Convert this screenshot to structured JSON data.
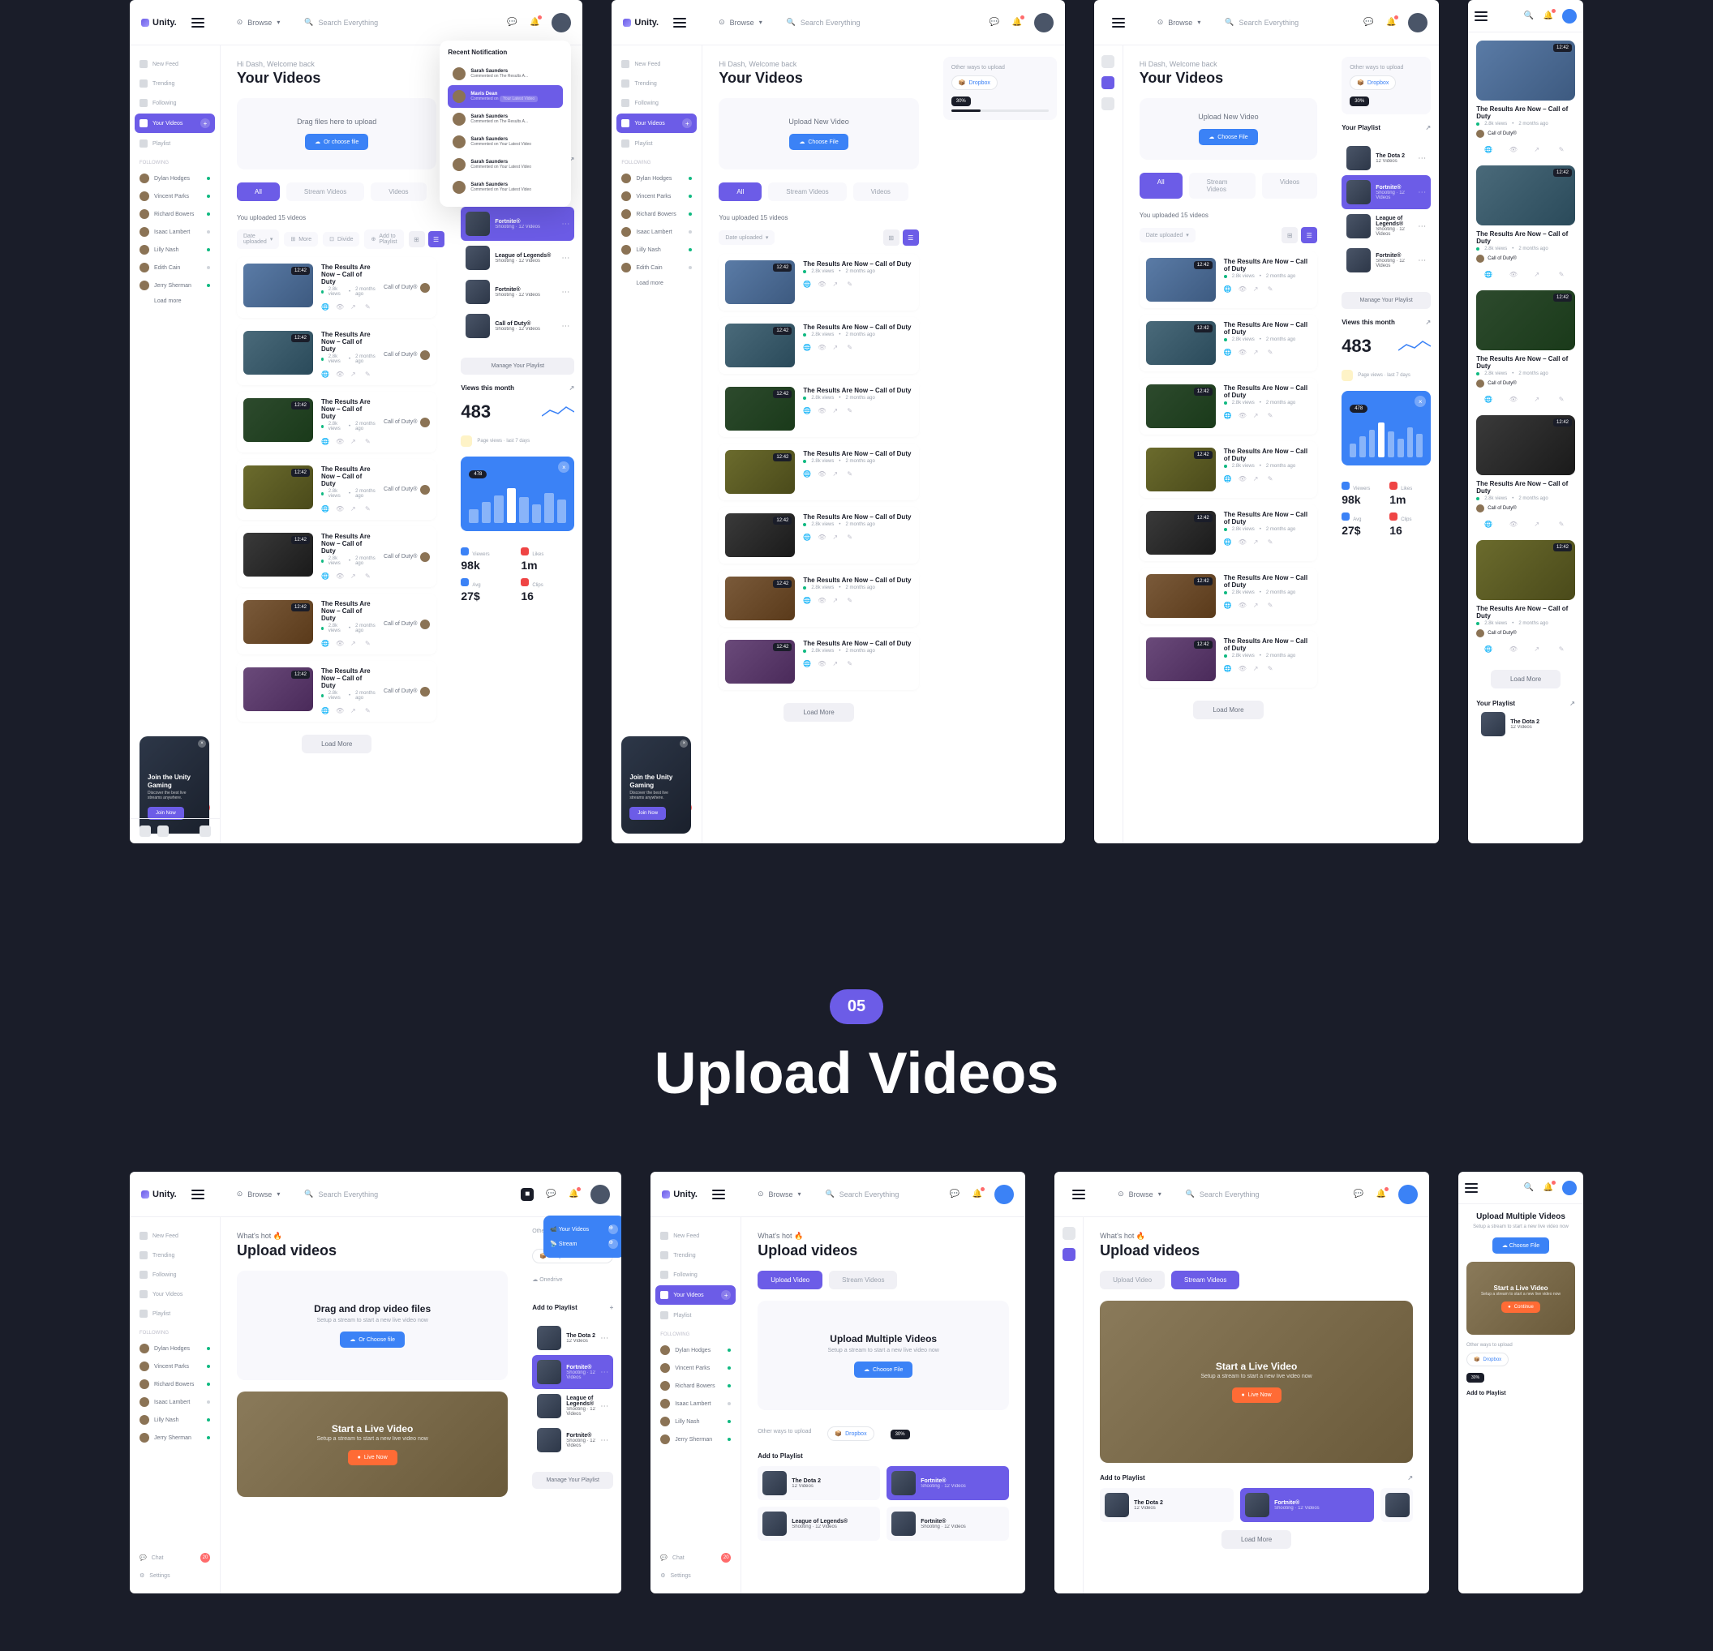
{
  "brand": "Unity.",
  "topbar": {
    "browse": "Browse",
    "search_placeholder": "Search Everything"
  },
  "sidebar": {
    "nav": [
      {
        "label": "New Feed"
      },
      {
        "label": "Trending"
      },
      {
        "label": "Following"
      },
      {
        "label": "Your Videos",
        "active": true
      },
      {
        "label": "Playlist"
      }
    ],
    "friends_head": "Following",
    "friends": [
      {
        "name": "Dylan Hodges",
        "online": true
      },
      {
        "name": "Vincent Parks",
        "online": true
      },
      {
        "name": "Richard Bowers",
        "online": true
      },
      {
        "name": "Isaac Lambert",
        "online": false
      },
      {
        "name": "Lilly Nash",
        "online": true
      },
      {
        "name": "Edith Cain",
        "online": false
      },
      {
        "name": "Jerry Sherman",
        "online": true
      },
      {
        "name": "Load more"
      }
    ],
    "chat": "Chat",
    "chat_badge": "20",
    "settings": "Settings"
  },
  "page": {
    "greeting": "Hi Dash, Welcome back",
    "title": "Your Videos",
    "drop_hint": "Drag files here to upload",
    "choose_btn": "Or choose file",
    "upload_new": "Upload New Video",
    "choose_file": "Choose File",
    "tabs": [
      "All",
      "Stream Videos",
      "Videos"
    ],
    "count": "You uploaded 15 videos",
    "filters": [
      "Date uploaded",
      "More",
      "Divide",
      "Add to Playlist"
    ],
    "load_more": "Load More"
  },
  "videos": [
    {
      "title": "The Results Are Now – Call of Duty",
      "views": "2.8k views",
      "ago": "2 months ago",
      "dur": "12:42",
      "game": "Call of Duty®"
    },
    {
      "title": "The Results Are Now – Call of Duty",
      "views": "2.8k views",
      "ago": "2 months ago",
      "dur": "12:42",
      "game": "Call of Duty®"
    },
    {
      "title": "The Results Are Now – Call of Duty",
      "views": "2.8k views",
      "ago": "2 months ago",
      "dur": "12:42",
      "game": "Call of Duty®"
    },
    {
      "title": "The Results Are Now – Call of Duty",
      "views": "2.8k views",
      "ago": "2 months ago",
      "dur": "12:42",
      "game": "Call of Duty®"
    },
    {
      "title": "The Results Are Now – Call of Duty",
      "views": "2.8k views",
      "ago": "2 months ago",
      "dur": "12:42",
      "game": "Call of Duty®"
    },
    {
      "title": "The Results Are Now – Call of Duty",
      "views": "2.8k views",
      "ago": "2 months ago",
      "dur": "12:42",
      "game": "Call of Duty®"
    },
    {
      "title": "The Results Are Now – Call of Duty",
      "views": "2.8k views",
      "ago": "2 months ago",
      "dur": "12:42",
      "game": "Call of Duty®"
    }
  ],
  "right": {
    "other_ways": "Other ways to upload",
    "dropbox": "Dropbox",
    "drive": "Onedrive",
    "percent": "30%",
    "playlist_head": "Your Playlist",
    "playlist": [
      {
        "t": "The Dota 2",
        "s": "12 Videos"
      },
      {
        "t": "Fortnite®",
        "s": "Shooting · 12 Videos",
        "sel": true
      },
      {
        "t": "League of Legends®",
        "s": "Shooting · 12 Videos"
      },
      {
        "t": "Fortnite®",
        "s": "Shooting · 12 Videos"
      },
      {
        "t": "Call of Duty®",
        "s": "Shooting · 12 Videos"
      }
    ],
    "manage": "Manage Your Playlist",
    "views_head": "Views this month",
    "views_num": "483",
    "views_sub": "Page views · last 7 days",
    "chart_badge": "478",
    "stats": [
      {
        "label": "Viewers",
        "value": "98k"
      },
      {
        "label": "Likes",
        "value": "1m"
      },
      {
        "label": "Avg",
        "value": "27$"
      },
      {
        "label": "Clips",
        "value": "16"
      }
    ]
  },
  "notif": {
    "head": "Recent Notification",
    "items": [
      {
        "name": "Sarah Saunders",
        "desc": "Commented on The Results A..."
      },
      {
        "name": "Mavis Dean",
        "desc": "Commented on",
        "tag": "Your Latest Video",
        "hl": true
      },
      {
        "name": "Sarah Saunders",
        "desc": "Commented on The Results A..."
      },
      {
        "name": "Sarah Saunders",
        "desc": "Commented on Your Latest Video"
      },
      {
        "name": "Sarah Saunders",
        "desc": "Commented on Your Latest Video"
      },
      {
        "name": "Sarah Saunders",
        "desc": "Commented on Your Latest Video"
      }
    ]
  },
  "promo": {
    "title": "Join the Unity Gaming",
    "sub": "Discover the best live streams anywhere.",
    "btn": "Join Now"
  },
  "section": {
    "num": "05",
    "title": "Upload Videos"
  },
  "upload": {
    "hot": "What's hot 🔥",
    "title": "Upload videos",
    "drop_title": "Drag and drop video files",
    "drop_sub": "Setup a stream to start a new live video now",
    "choose": "Or Choose file",
    "live_title": "Start a Live Video",
    "live_sub": "Setup a stream to start a new live video now",
    "live_btn": "Live Now",
    "multi_title": "Upload Multiple Videos",
    "multi_sub": "Setup a stream to start a new live video now",
    "tabs": [
      "Upload Video",
      "Stream Videos"
    ],
    "add_playlist": "Add to Playlist",
    "mob_title": "Upload Multiple Videos",
    "mob_btn": "Choose File",
    "continue": "Continue"
  },
  "chart_data": {
    "type": "bar",
    "title": "Views this month",
    "big_value": 483,
    "badge_value": 478,
    "values": [
      30,
      45,
      60,
      75,
      55,
      40,
      65,
      50
    ],
    "highlight_index": 3,
    "stats": {
      "viewers": "98k",
      "likes": "1m",
      "avg": "27$",
      "clips": 16
    }
  }
}
